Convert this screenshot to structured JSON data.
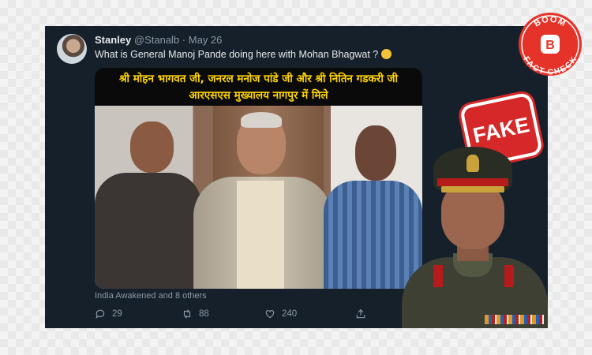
{
  "tweet": {
    "display_name": "Stanley",
    "handle": "@Stanalb",
    "separator": "·",
    "date": "May 26",
    "text": "What is General Manoj Pande doing here with Mohan Bhagwat ?",
    "emoji": "thinking-face-emoji"
  },
  "media": {
    "banner_line1": "श्री मोहन भागवत जी, जनरल मनोज पांडे जी और श्री नितिन गडकरी जी",
    "banner_line2": "आरएसएस मुख्यालय नागपुर में मिले",
    "stamp_text": "FAKE"
  },
  "footer": {
    "liked_by": "India Awakened and 8 others",
    "replies": "29",
    "retweets": "88",
    "likes": "240"
  },
  "badge": {
    "top_text": "BOOM",
    "bottom_text": "FACT CHECK",
    "letter": "B"
  },
  "colors": {
    "tweet_bg": "#15202b",
    "banner_text": "#ffd400",
    "stamp_red": "#d62828",
    "badge_red": "#e63329"
  }
}
